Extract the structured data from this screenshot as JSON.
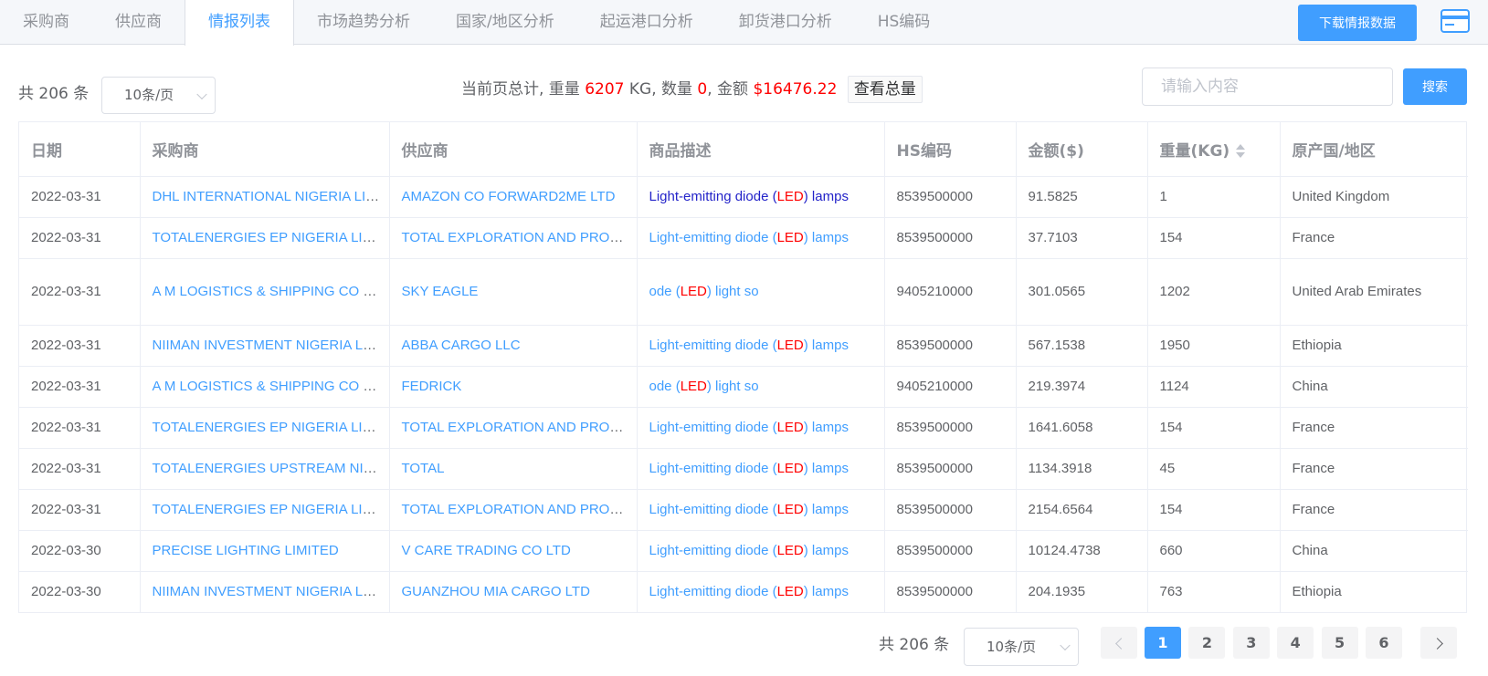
{
  "tabs": [
    "采购商",
    "供应商",
    "情报列表",
    "市场趋势分析",
    "国家/地区分析",
    "起运港口分析",
    "卸货港口分析",
    "HS编码"
  ],
  "active_tab": 2,
  "download_label": "下载情报数据",
  "toolbar": {
    "total_text": "共 206 条",
    "page_size": "10条/页",
    "summary_prefix": "当前页总计, 重量 ",
    "weight_value": "6207",
    "weight_unit": " KG, 数量 ",
    "quantity_value": "0",
    "amount_label": ", 金额 ",
    "amount_value": "$16476.22",
    "view_total_label": "查看总量",
    "search_placeholder": "请输入内容",
    "search_label": "搜索"
  },
  "table": {
    "headers": [
      "日期",
      "采购商",
      "供应商",
      "商品描述",
      "HS编码",
      "金额($)",
      "重量(KG)",
      "原产国/地区"
    ],
    "rows": [
      {
        "date": "2022-03-31",
        "buyer": "DHL INTERNATIONAL NIGERIA LIMITED",
        "supplier": "AMAZON CO FORWARD2ME LTD",
        "desc_a": "Light-emitting diode (",
        "desc_led": "LED",
        "desc_b": ") lamps",
        "dark": true,
        "hs": "8539500000",
        "amount": "91.5825",
        "weight": "1",
        "origin": "United Kingdom"
      },
      {
        "date": "2022-03-31",
        "buyer": "TOTALENERGIES EP NIGERIA LIMITED",
        "supplier": "TOTAL EXPLORATION AND PRODUCTION",
        "desc_a": "Light-emitting diode (",
        "desc_led": "LED",
        "desc_b": ") lamps",
        "dark": false,
        "hs": "8539500000",
        "amount": "37.7103",
        "weight": "154",
        "origin": "France"
      },
      {
        "date": "2022-03-31",
        "buyer": "A M LOGISTICS & SHIPPING CO LIMITED",
        "supplier": "SKY EAGLE",
        "desc_a": "ode (",
        "desc_led": "LED",
        "desc_b": ") light so",
        "dark": false,
        "hs": "9405210000",
        "amount": "301.0565",
        "weight": "1202",
        "origin": "United Arab Emirates",
        "tall": true
      },
      {
        "date": "2022-03-31",
        "buyer": "NIIMAN INVESTMENT NIGERIA LIMITED",
        "supplier": "ABBA CARGO LLC",
        "desc_a": "Light-emitting diode (",
        "desc_led": "LED",
        "desc_b": ") lamps",
        "dark": false,
        "hs": "8539500000",
        "amount": "567.1538",
        "weight": "1950",
        "origin": "Ethiopia"
      },
      {
        "date": "2022-03-31",
        "buyer": "A M LOGISTICS & SHIPPING CO LIMITED",
        "supplier": "FEDRICK",
        "desc_a": "ode (",
        "desc_led": "LED",
        "desc_b": ") light so",
        "dark": false,
        "hs": "9405210000",
        "amount": "219.3974",
        "weight": "1124",
        "origin": "China"
      },
      {
        "date": "2022-03-31",
        "buyer": "TOTALENERGIES EP NIGERIA LIMITED",
        "supplier": "TOTAL EXPLORATION AND PRODUCTION",
        "desc_a": "Light-emitting diode (",
        "desc_led": "LED",
        "desc_b": ") lamps",
        "dark": false,
        "hs": "8539500000",
        "amount": "1641.6058",
        "weight": "154",
        "origin": "France"
      },
      {
        "date": "2022-03-31",
        "buyer": "TOTALENERGIES UPSTREAM NIGERIA LIMITED",
        "supplier": "TOTAL",
        "desc_a": "Light-emitting diode (",
        "desc_led": "LED",
        "desc_b": ") lamps",
        "dark": false,
        "hs": "8539500000",
        "amount": "1134.3918",
        "weight": "45",
        "origin": "France"
      },
      {
        "date": "2022-03-31",
        "buyer": "TOTALENERGIES EP NIGERIA LIMITED",
        "supplier": "TOTAL EXPLORATION AND PRODUCTION",
        "desc_a": "Light-emitting diode (",
        "desc_led": "LED",
        "desc_b": ") lamps",
        "dark": false,
        "hs": "8539500000",
        "amount": "2154.6564",
        "weight": "154",
        "origin": "France"
      },
      {
        "date": "2022-03-30",
        "buyer": "PRECISE LIGHTING LIMITED",
        "supplier": "V CARE TRADING CO LTD",
        "desc_a": "Light-emitting diode (",
        "desc_led": "LED",
        "desc_b": ") lamps",
        "dark": false,
        "hs": "8539500000",
        "amount": "10124.4738",
        "weight": "660",
        "origin": "China"
      },
      {
        "date": "2022-03-30",
        "buyer": "NIIMAN INVESTMENT NIGERIA LIMITED",
        "supplier": "GUANZHOU MIA CARGO LTD",
        "desc_a": "Light-emitting diode (",
        "desc_led": "LED",
        "desc_b": ") lamps",
        "dark": false,
        "hs": "8539500000",
        "amount": "204.1935",
        "weight": "763",
        "origin": "Ethiopia"
      }
    ]
  },
  "pagination": {
    "total_text": "共 206 条",
    "page_size": "10条/页",
    "pages": [
      "1",
      "2",
      "3",
      "4",
      "5",
      "6"
    ],
    "current": "1"
  },
  "colors": {
    "accent": "#409eff",
    "highlight": "#ff0000"
  }
}
